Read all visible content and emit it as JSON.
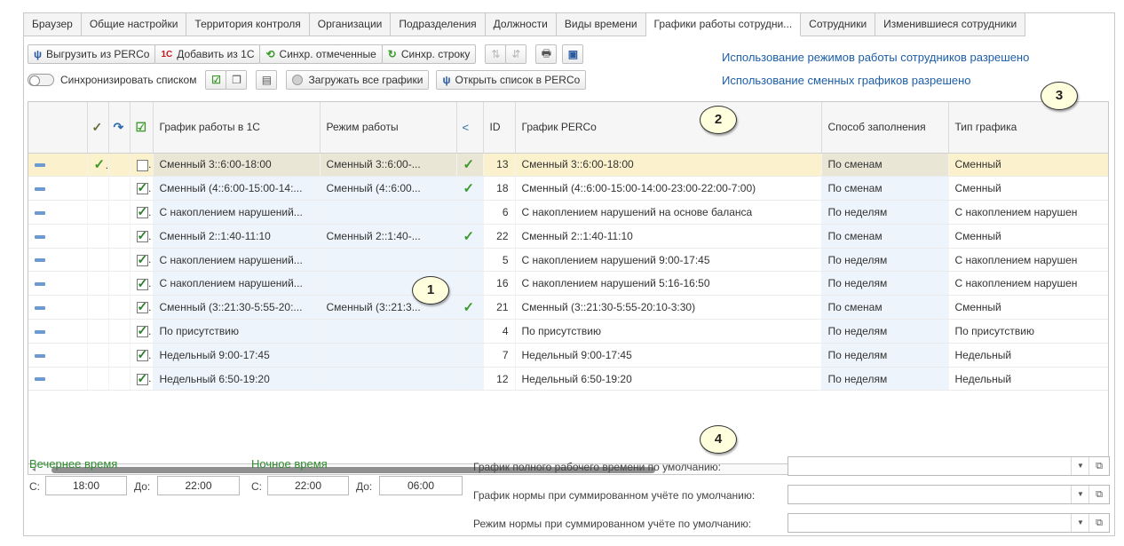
{
  "tabs": [
    "Браузер",
    "Общие настройки",
    "Территория контроля",
    "Организации",
    "Подразделения",
    "Должности",
    "Виды времени",
    "Графики работы сотрудни...",
    "Сотрудники",
    "Изменившиеся сотрудники"
  ],
  "active_tab_index": 7,
  "toolbar": {
    "export_label": "Выгрузить из PERCo",
    "add_label": "Добавить из 1С",
    "sync_marked_label": "Синхр. отмеченные",
    "sync_row_label": "Синхр. строку",
    "sync_list_label": "Синхронизировать списком",
    "load_all_label": "Загружать все графики",
    "open_list_label": "Открыть список в PERCo",
    "logo_1c": "1С"
  },
  "info_links": {
    "modes_allowed": "Использование режимов работы сотрудников разрешено",
    "shifts_allowed": "Использование сменных графиков разрешено"
  },
  "callouts": [
    "1",
    "2",
    "3",
    "4"
  ],
  "grid": {
    "columns": {
      "schedule_1c": "График работы в 1С",
      "mode": "Режим работы",
      "id": "ID",
      "perco": "График PERCo",
      "fill": "Способ заполнения",
      "type": "Тип графика"
    },
    "rows": [
      {
        "checked": false,
        "synced": true,
        "schedule_1c": "Сменный 3::6:00-18:00",
        "mode": "Сменный 3::6:00-...",
        "match": true,
        "id": "13",
        "perco": "Сменный 3::6:00-18:00",
        "fill": "По сменам",
        "type": "Сменный"
      },
      {
        "checked": true,
        "synced": false,
        "schedule_1c": "Сменный (4::6:00-15:00-14:...",
        "mode": "Сменный (4::6:00...",
        "match": true,
        "id": "18",
        "perco": "Сменный (4::6:00-15:00-14:00-23:00-22:00-7:00)",
        "fill": "По сменам",
        "type": "Сменный"
      },
      {
        "checked": true,
        "synced": false,
        "schedule_1c": "С накоплением нарушений...",
        "mode": "",
        "match": false,
        "id": "6",
        "perco": "С накоплением нарушений на основе баланса",
        "fill": "По неделям",
        "type": "С накоплением нарушен"
      },
      {
        "checked": true,
        "synced": false,
        "schedule_1c": "Сменный 2::1:40-11:10",
        "mode": "Сменный 2::1:40-...",
        "match": true,
        "id": "22",
        "perco": "Сменный 2::1:40-11:10",
        "fill": "По сменам",
        "type": "Сменный"
      },
      {
        "checked": true,
        "synced": false,
        "schedule_1c": "С накоплением нарушений...",
        "mode": "",
        "match": false,
        "id": "5",
        "perco": "С накоплением нарушений 9:00-17:45",
        "fill": "По неделям",
        "type": "С накоплением нарушен"
      },
      {
        "checked": true,
        "synced": false,
        "schedule_1c": "С накоплением нарушений...",
        "mode": "",
        "match": false,
        "id": "16",
        "perco": "С накоплением нарушений 5:16-16:50",
        "fill": "По неделям",
        "type": "С накоплением нарушен"
      },
      {
        "checked": true,
        "synced": false,
        "schedule_1c": "Сменный (3::21:30-5:55-20:...",
        "mode": "Сменный (3::21:3...",
        "match": true,
        "id": "21",
        "perco": "Сменный (3::21:30-5:55-20:10-3:30)",
        "fill": "По сменам",
        "type": "Сменный"
      },
      {
        "checked": true,
        "synced": false,
        "schedule_1c": "По присутствию",
        "mode": "",
        "match": false,
        "id": "4",
        "perco": "По присутствию",
        "fill": "По неделям",
        "type": "По присутствию"
      },
      {
        "checked": true,
        "synced": false,
        "schedule_1c": "Недельный 9:00-17:45",
        "mode": "",
        "match": false,
        "id": "7",
        "perco": "Недельный 9:00-17:45",
        "fill": "По неделям",
        "type": "Недельный"
      },
      {
        "checked": true,
        "synced": false,
        "schedule_1c": "Недельный 6:50-19:20",
        "mode": "",
        "match": false,
        "id": "12",
        "perco": "Недельный 6:50-19:20",
        "fill": "По неделям",
        "type": "Недельный"
      }
    ]
  },
  "evening": {
    "title": "Вечернее время",
    "from_label": "С:",
    "from": "18:00",
    "to_label": "До:",
    "to": "22:00"
  },
  "night": {
    "title": "Ночное время",
    "from_label": "С:",
    "from": "22:00",
    "to_label": "До:",
    "to": "06:00"
  },
  "defaults": {
    "full_time_label": "График полного рабочего времени по умолчанию:",
    "norm_schedule_label": "График нормы при суммированном учёте по умолчанию:",
    "norm_mode_label": "Режим нормы при суммированном учёте по умолчанию:"
  },
  "colors": {
    "accent_link": "#1c5ea8",
    "selected_row": "#fbf1cc",
    "check_green": "#3a9a2a",
    "label_green": "#2e8b2e",
    "callout_fill": "#ffffdd"
  }
}
